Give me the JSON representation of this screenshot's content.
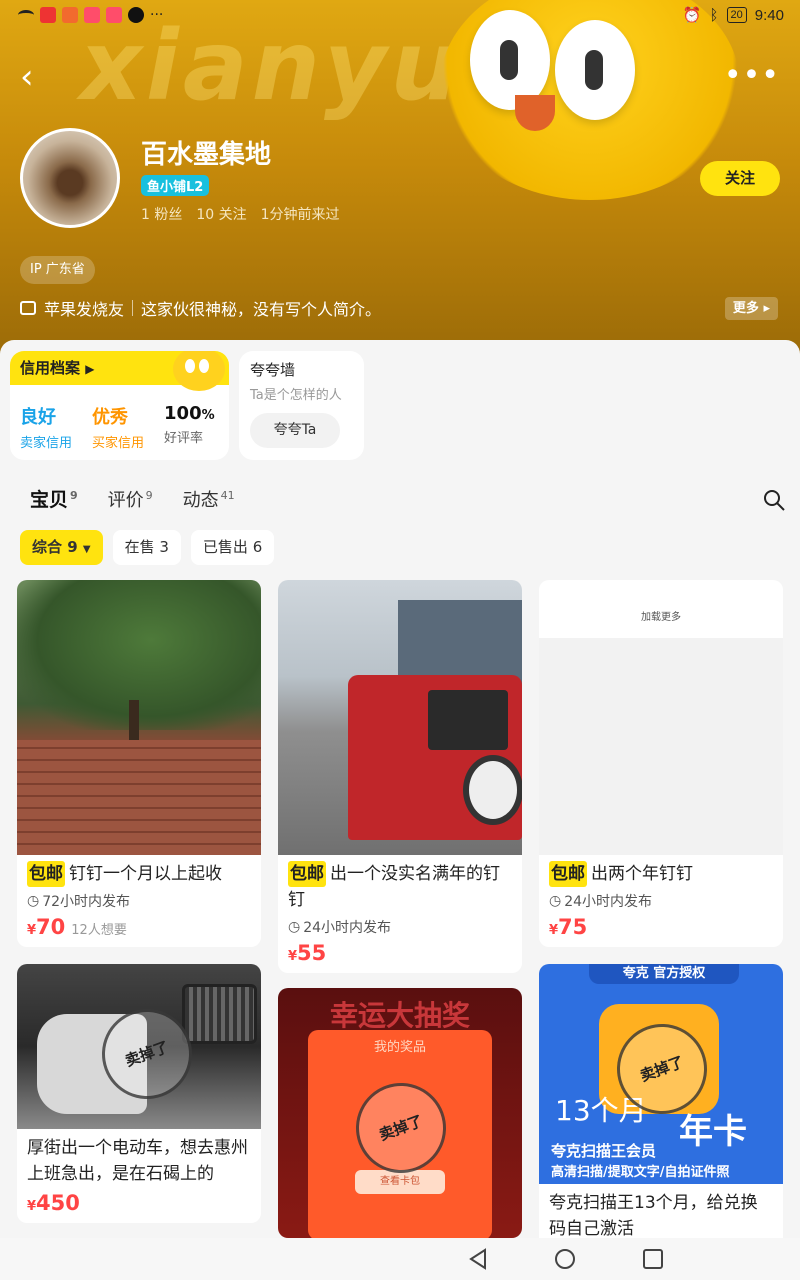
{
  "status_bar": {
    "time": "9:40",
    "battery": "20"
  },
  "shop": {
    "name": "百水墨集地",
    "level_badge": "鱼小铺L2",
    "fans": "1 粉丝",
    "following": "10 关注",
    "last_seen": "1分钟前来过",
    "follow_label": "关注",
    "ip_location": "IP 广东省",
    "tag": "苹果发烧友",
    "bio": "这家伙很神秘，没有写个人简介。",
    "more_label": "更多"
  },
  "credit": {
    "title": "信用档案",
    "seller_credit_value": "良好",
    "seller_credit_label": "卖家信用",
    "buyer_credit_value": "优秀",
    "buyer_credit_label": "买家信用",
    "rating_value": "100",
    "rating_unit": "%",
    "rating_label": "好评率"
  },
  "praise_wall": {
    "title": "夸夸墙",
    "subtitle": "Ta是个怎样的人",
    "button": "夸夸Ta"
  },
  "tabs": [
    {
      "label": "宝贝",
      "count": "9"
    },
    {
      "label": "评价",
      "count": "9"
    },
    {
      "label": "动态",
      "count": "41"
    }
  ],
  "filters": [
    {
      "label": "综合 9"
    },
    {
      "label": "在售 3"
    },
    {
      "label": "已售出 6"
    }
  ],
  "items": [
    {
      "tag": "包邮",
      "title": "钉钉一个月以上起收",
      "time": "72小时内发布",
      "currency": "¥",
      "price": "70",
      "wants": "12人想要"
    },
    {
      "tag": "包邮",
      "title": "出一个没实名满年的钉钉",
      "time": "24小时内发布",
      "currency": "¥",
      "price": "55"
    },
    {
      "tag": "包邮",
      "title": "出两个年钉钉",
      "time": "24小时内发布",
      "currency": "¥",
      "price": "75",
      "image_text": "加载更多"
    },
    {
      "title": "厚街出一个电动车，想去惠州上班急出，是在石碣上的",
      "currency": "¥",
      "price": "450",
      "stamp": "卖掉了"
    },
    {
      "image_text_1": "幸运大抽奖",
      "image_text_2": "我的奖品",
      "image_text_3": "查看卡包",
      "stamp": "卖掉了"
    },
    {
      "title": "夸克扫描王13个月，给兑换码自己激活",
      "image_text_1": "夸克 官方授权",
      "image_text_2": "13个月",
      "image_text_3": "年卡",
      "image_text_4": "夸克扫描王会员",
      "image_text_5": "高清扫描/提取文字/自拍证件照",
      "stamp": "卖掉了"
    }
  ],
  "colors": {
    "brand_yellow": "#ffe30f",
    "price_red": "#ff4444",
    "good_blue": "#1aa3e8",
    "excellent_orange": "#ff9500"
  }
}
